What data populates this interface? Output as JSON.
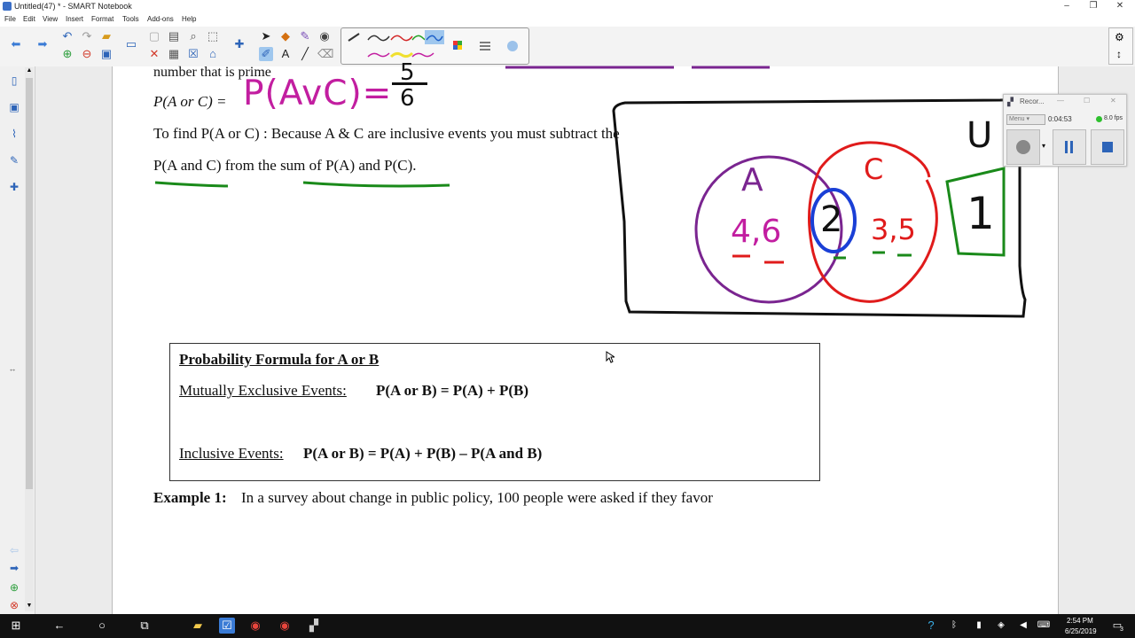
{
  "window": {
    "title": "Untitled(47) * - SMART Notebook"
  },
  "menu": [
    "File",
    "Edit",
    "View",
    "Insert",
    "Format",
    "Tools",
    "Add-ons",
    "Help"
  ],
  "page": {
    "line_top": "number that is prime",
    "p_a_or_c": "P(A or C) =",
    "hw_formula": "P(AvC)=",
    "hw_fraction_num": "5",
    "hw_fraction_den": "6",
    "find_line": "To find P(A or C) :  Because A & C are inclusive events you must subtract the",
    "from_line": "P(A and C) from the sum of P(A) and P(C).",
    "box_title": "Probability Formula for A or B",
    "mutual_label": "Mutually Exclusive Events:",
    "mutual_formula": "P(A or B) = P(A) + P(B)",
    "inclusive_label": "Inclusive Events:",
    "inclusive_formula": "P(A or B) = P(A) + P(B) – P(A and B)",
    "example_label": "Example 1:",
    "example_text": "In a survey about change in public policy, 100 people were asked if they favor"
  },
  "venn": {
    "universe": "U",
    "set_a": "A",
    "set_c": "C",
    "a_values": "4,6",
    "intersection": "2",
    "c_values": "3,5",
    "outside": "1"
  },
  "recorder": {
    "title": "Recor...",
    "menu": "Menu",
    "time": "0:04:53",
    "fps": "8.0 fps"
  },
  "taskbar": {
    "time": "2:54 PM",
    "date": "6/25/2019",
    "notifications": "3"
  },
  "colors": {
    "purple": "#7a2590",
    "red": "#e01b1b",
    "green": "#1a8a1a",
    "blue": "#1a3fd6",
    "magenta": "#c21ea0"
  }
}
